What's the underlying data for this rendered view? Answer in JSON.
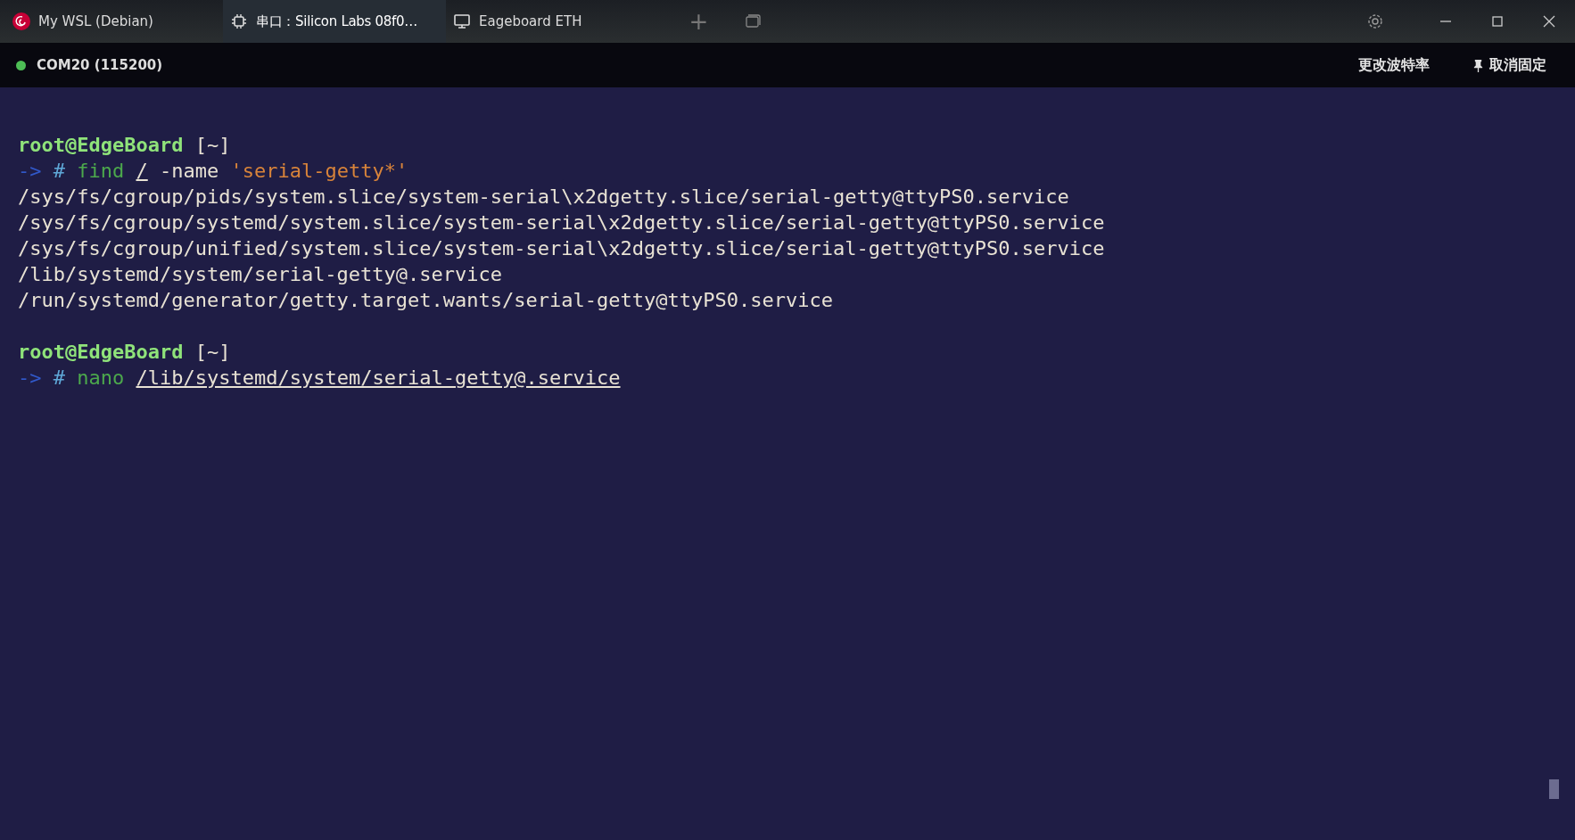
{
  "tabs": [
    {
      "label": "My WSL (Debian)",
      "kind": "distro",
      "selected": false
    },
    {
      "label": "串口：Silicon Labs 08f0…",
      "kind": "serial",
      "selected": true
    },
    {
      "label": "Eageboard ETH",
      "kind": "ssh",
      "selected": false
    }
  ],
  "window_controls": {
    "new_tab": "+"
  },
  "status_bar": {
    "connected": true,
    "port": "COM20 (115200)",
    "actions": [
      {
        "label": "更改波特率",
        "kind": "plain"
      },
      {
        "label": "取消固定",
        "kind": "pin"
      }
    ]
  },
  "terminal": {
    "lines": [
      {
        "kind": "text",
        "segments": [
          {
            "text": "root@EdgeBoard",
            "kind": "user"
          },
          {
            "text": " [~]",
            "kind": "dir"
          }
        ]
      },
      {
        "kind": "text",
        "segments": [
          {
            "text": "->",
            "kind": "arrow"
          },
          {
            "text": " #",
            "kind": "hash"
          },
          {
            "text": " find ",
            "kind": "cmd"
          },
          {
            "text": "/",
            "kind": "path"
          },
          {
            "text": " -name",
            "kind": "plain"
          },
          {
            "text": " 'serial-getty*'",
            "kind": "string"
          }
        ]
      },
      {
        "kind": "text",
        "segments": [
          {
            "text": "/sys/fs/cgroup/pids/system.slice/system-serial\\x2dgetty.slice/serial-getty@ttyPS0.service",
            "kind": "plain"
          }
        ]
      },
      {
        "kind": "text",
        "segments": [
          {
            "text": "/sys/fs/cgroup/systemd/system.slice/system-serial\\x2dgetty.slice/serial-getty@ttyPS0.service",
            "kind": "plain"
          }
        ]
      },
      {
        "kind": "text",
        "segments": [
          {
            "text": "/sys/fs/cgroup/unified/system.slice/system-serial\\x2dgetty.slice/serial-getty@ttyPS0.service",
            "kind": "plain"
          }
        ]
      },
      {
        "kind": "text",
        "segments": [
          {
            "text": "/lib/systemd/system/serial-getty@.service",
            "kind": "plain"
          }
        ]
      },
      {
        "kind": "text",
        "segments": [
          {
            "text": "/run/systemd/generator/getty.target.wants/serial-getty@ttyPS0.service",
            "kind": "plain"
          }
        ]
      },
      {
        "kind": "blank"
      },
      {
        "kind": "text",
        "segments": [
          {
            "text": "root@EdgeBoard",
            "kind": "user"
          },
          {
            "text": " [~]",
            "kind": "dir"
          }
        ]
      },
      {
        "kind": "text",
        "segments": [
          {
            "text": "->",
            "kind": "arrow"
          },
          {
            "text": " #",
            "kind": "hash"
          },
          {
            "text": " nano ",
            "kind": "cmd"
          },
          {
            "text": "/lib/systemd/system/serial-getty@.service",
            "kind": "path"
          }
        ]
      }
    ]
  }
}
